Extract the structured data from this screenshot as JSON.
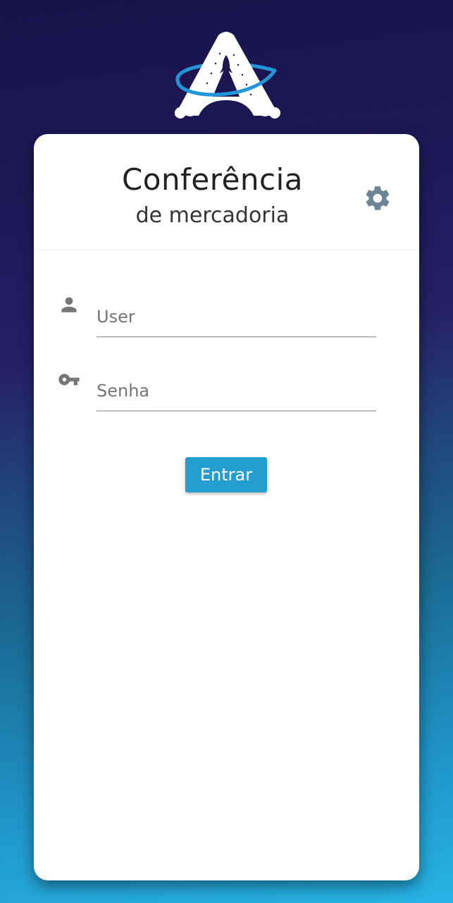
{
  "header": {
    "title": "Conferência",
    "subtitle": "de mercadoria"
  },
  "icons": {
    "logo": "rocket-logo-icon",
    "settings": "gear-icon",
    "user": "person-icon",
    "password": "key-icon"
  },
  "form": {
    "user_placeholder": "User",
    "password_placeholder": "Senha",
    "submit_label": "Entrar"
  },
  "colors": {
    "background_top": "#18124a",
    "background_bottom": "#27b4e6",
    "accent": "#239ecf",
    "gear": "#6b8595",
    "icon_gray": "#777777"
  }
}
